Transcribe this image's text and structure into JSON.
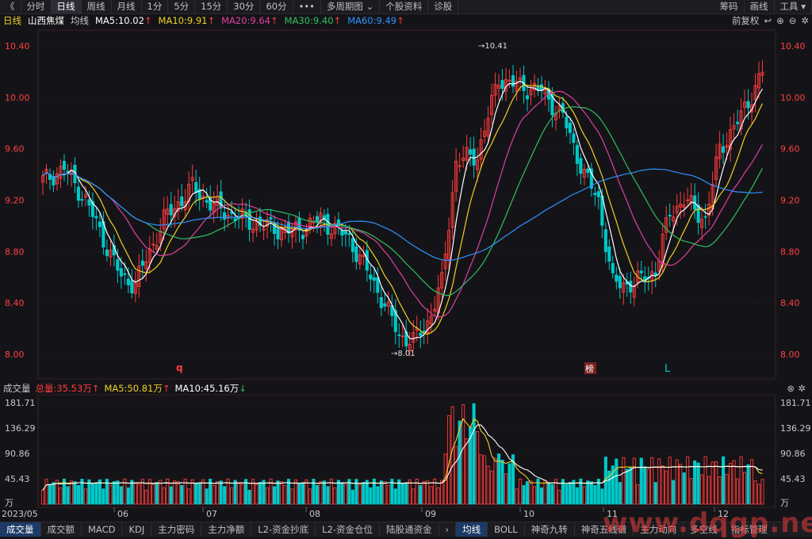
{
  "toolbar": {
    "left": [
      "《",
      "分时",
      "日线",
      "周线",
      "月线",
      "1分",
      "5分",
      "15分",
      "30分",
      "60分",
      "•••",
      "多周期图 ⌄",
      "个股资料",
      "诊股"
    ],
    "active_index": 2,
    "right": [
      "筹码",
      "画线",
      "工具 ▾"
    ]
  },
  "legend": {
    "period": "日线",
    "stock": "山西焦煤",
    "ma_type": "均线",
    "ma5": "MA5:10.02",
    "ma10": "MA10:9.91",
    "ma20": "MA20:9.64",
    "ma30": "MA30:9.40",
    "ma60": "MA60:9.49",
    "fq": "前复权"
  },
  "price_axis": {
    "ticks": [
      "10.40",
      "10.00",
      "9.60",
      "9.20",
      "8.80",
      "8.40",
      "8.00"
    ]
  },
  "annotations": {
    "high": "10.41",
    "low": "8.01",
    "mark_q": "q",
    "mark_bang": "榜",
    "mark_l": "L"
  },
  "volume": {
    "label": "成交量",
    "total": "总量:35.53万",
    "ma5": "MA5:50.81万",
    "ma10": "MA10:45.16万",
    "ticks": [
      "181.71",
      "136.29",
      "90.86",
      "45.43",
      "万"
    ]
  },
  "date_axis": [
    "2023/05",
    "06",
    "07",
    "08",
    "09",
    "10",
    "11",
    "12"
  ],
  "bottom_tabs": [
    "成交量",
    "成交额",
    "MACD",
    "KDJ",
    "主力密码",
    "主力净额",
    "L2-资金抄底",
    "L2-资金仓位",
    "陆股通资金",
    "›",
    "均线",
    "BOLL",
    "神奇九转",
    "神奇五线谱",
    "主力动向",
    "多空线",
    "指标管理"
  ],
  "watermark": "www.dqgp.net",
  "colors": {
    "up": "#ff3b3b",
    "down": "#00c8c8",
    "ma5": "#ffffff",
    "ma10": "#f0d020",
    "ma20": "#e040a0",
    "ma30": "#30c060",
    "ma60": "#3090ff"
  }
}
